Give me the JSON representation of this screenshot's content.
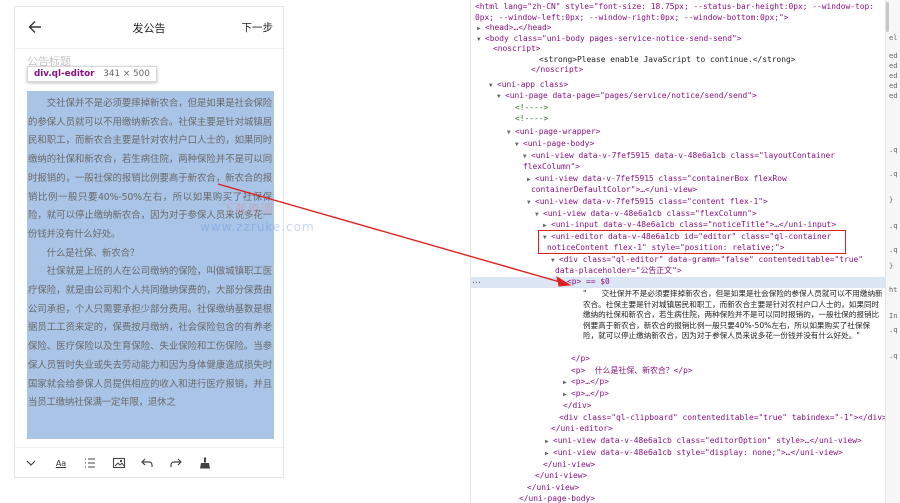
{
  "phone": {
    "nav_title": "发公告",
    "nav_next": "下一步",
    "title_placeholder": "公告标题",
    "tooltip_tag": "div.ql-editor",
    "tooltip_size": "341 × 500",
    "paragraphs": [
      "交社保并不是必须要摔掉新农合，但是如果是社会保险的参保人员就可以不用缴纳新农合。社保主要是针对城镇居民和职工，而新农合主要是针对农村户口人士的，如果同时缴纳的社保和新农合，若生病住院，两种保险并不是可以同时报销的，一般社保的报销比例要高于新农合，新农合的报销比例一般只要40%-50%左右，所以如果购买了社保保险，就可以停止缴纳新农合，因为对于参保人员来说多花一份钱并没有什么好处。",
      "什么是社保、新农合？",
      "社保就是上班的人在公司缴纳的保险，叫做城镇职工医疗保险，就是由公司和个人共同缴纳保费的，大部分保费由公司承担，个人只需要承担少部分费用。社保缴纳基数是根据员工工资来定的，保费按月缴纳，社会保险包含的有养老保险、医疗保险以及生育保险、失业保险和工伤保险。当参保人员暂时失业或失去劳动能力和因为身体健康造成损失时国家就会给参保人员提供相应的收入和进行医疗报销，并且当员工缴纳社保满一定年限，退休之"
    ],
    "watermark_1": "www.zzruke.com",
    "watermark_2": "下载资源",
    "toolbar": {
      "items": [
        "chevron-down-icon",
        "text-format",
        "list-icon",
        "image-icon",
        "undo-icon",
        "redo-icon",
        "clear-format-icon"
      ],
      "text_format_label": "Aa"
    }
  },
  "devtools": {
    "lines": {
      "l1": "<html lang=\"zh-CN\" style=\"font-size: 18.75px; --status-bar-height:0px; --window-top:",
      "l2": "0px; --window-left:0px; --window-right:0px; --window-bottom:0px;\">",
      "l3": "<head>…</head>",
      "l4": "<body class=\"uni-body pages-service-notice-send-send\">",
      "l5": "<noscript>",
      "l6": "<strong>Please enable JavaScript to continue.</strong>",
      "l7": "</noscript>",
      "l8": "<uni-app class>",
      "l9": "<uni-page data-page=\"pages/service/notice/send/send\">",
      "l10": "<!---->",
      "l11": "<!---->",
      "l12": "<uni-page-wrapper>",
      "l13": "<uni-page-body>",
      "l14": "<uni-view data-v-7fef5915 data-v-48e6a1cb class=\"layoutContainer",
      "l15": "flexColumn\">",
      "l16": "<uni-view data-v-7fef5915 class=\"containerBox flexRow",
      "l17": "containerDefaultColor\">…</uni-view>",
      "l18": "<uni-view data-v-7fef5915 class=\"content flex-1\">",
      "l19": "<uni-view data-v-48e6a1cb class=\"flexColumn\">",
      "l20": "<uni-input data-v-48e6a1cb class=\"noticeTitle\">…</uni-input>",
      "l21": "<uni-editor data-v-48e6a1cb id=\"editor\" class=\"ql-container",
      "l22": "noticeContent flex-1\" style=\"position: relative;\">",
      "l23": "<div class=\"ql-editor\" data-gramm=\"false\" contenteditable=\"true\"",
      "l24": "data-placeholder=\"公告正文\">",
      "l25": "<p> == $0",
      "p_content": "\"　　交社保并不是必须要摔掉新农合，但是如果是社会保险的参保人员就可以不用缴纳新农合。社保主要是针对城镇居民和职工，而新农合主要是针对农村户口人士的，如果同时缴纳的社保和新农合，若生病住院，两种保险并不是可以同时报销的，一般社保的报销比例要高于新农合，新农合的报销比例一般只要40%-50%左右，所以如果购买了社保保险，就可以停止缴纳新农合，因为对于参保人员来说多花一份钱并没有什么好处。\"",
      "l26": "</p>",
      "l27": "<p>  什么是社保、新农合？</p>",
      "l28": "<p>…</p>",
      "l29": "<p>…</p>",
      "l30": "</div>",
      "l31": "<div class=\"ql-clipboard\" contenteditable=\"true\" tabindex=\"-1\"></div>",
      "l32": "</uni-editor>",
      "l33": "<uni-view data-v-48e6a1cb class=\"editorOption\" style>…</uni-view>",
      "l34": "<uni-view data-v-48e6a1cb style=\"display: none;\">…</uni-view>",
      "l35": "</uni-view>",
      "l36": "</uni-view>",
      "l37": "</uni-view>",
      "l38": "</uni-page-body>"
    },
    "sidebar": [
      "el",
      "ed",
      "ed",
      "ed",
      "ed",
      "ed",
      ".q",
      ".q",
      "}",
      ".q",
      ".q",
      "}",
      "ht",
      "In",
      ".q",
      ".q"
    ],
    "ellipsis": "…"
  },
  "colors": {
    "highlight": "#a9c4e6",
    "annotation_red": "#e02020",
    "tag": "#881280"
  }
}
